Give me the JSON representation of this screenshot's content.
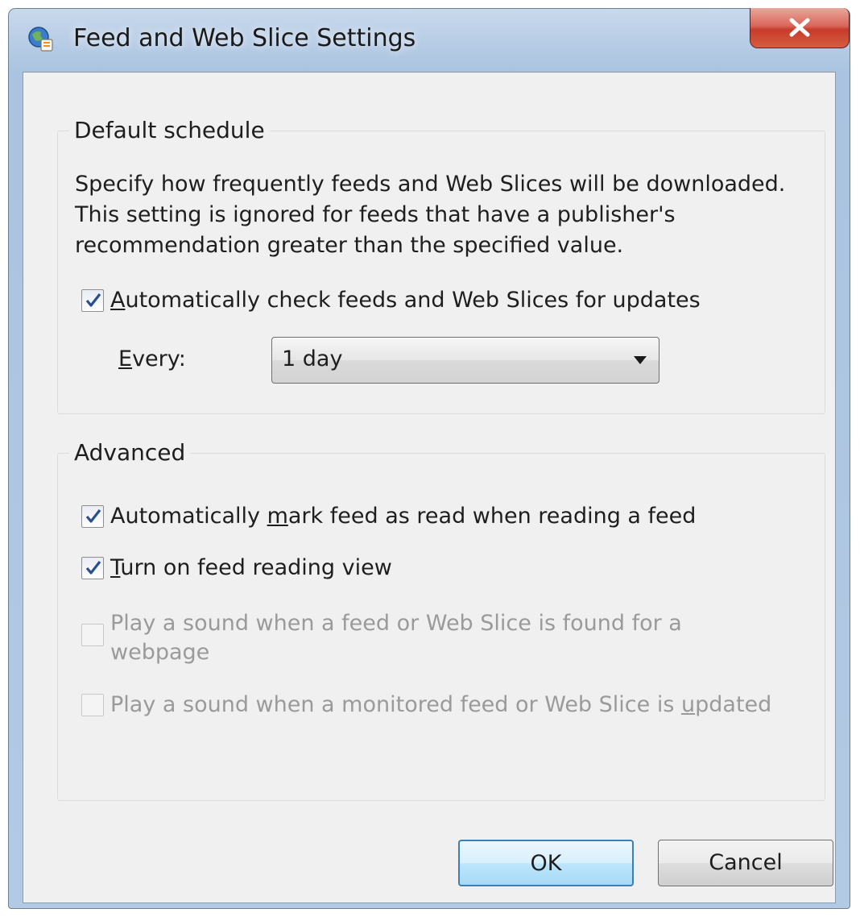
{
  "window": {
    "title": "Feed and Web Slice Settings",
    "close_label": "X"
  },
  "schedule": {
    "caption": "Default schedule",
    "description_lines": [
      "Specify how frequently feeds and Web Slices will be downloaded.",
      "This setting is ignored for feeds that have a publisher's",
      "recommendation greater than the specified value."
    ],
    "auto_check": {
      "label_prefix": "",
      "label_accel": "A",
      "label_rest": "utomatically check feeds and Web Slices for updates",
      "checked": true
    },
    "every": {
      "label_accel": "E",
      "label_rest": "very:",
      "value": "1 day"
    }
  },
  "advanced": {
    "caption": "Advanced",
    "mark_read": {
      "label_prefix": "Automatically ",
      "label_accel": "m",
      "label_rest": "ark feed as read when reading a feed",
      "checked": true
    },
    "reading_view": {
      "label_prefix": "",
      "label_accel": "T",
      "label_rest": "urn on feed reading view",
      "checked": true
    },
    "sound_found": {
      "label_line1": "Play a sound when a feed or Web Slice is found for a",
      "label_line2": "webpage",
      "checked": false,
      "enabled": false
    },
    "sound_updated": {
      "label_prefix": "Play a sound when a monitored feed or Web Slice is ",
      "label_accel": "u",
      "label_rest": "pdated",
      "checked": false,
      "enabled": false
    }
  },
  "buttons": {
    "ok": "OK",
    "cancel": "Cancel"
  },
  "colors": {
    "accent": "#3c7fb1",
    "close": "#c73b2a",
    "checkmark": "#2a4f8f"
  }
}
